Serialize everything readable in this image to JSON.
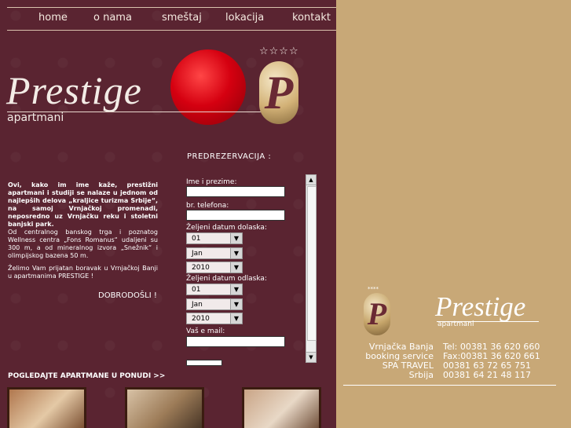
{
  "nav": {
    "items": [
      "home",
      "o nama",
      "smeštaj",
      "lokacija",
      "kontakt"
    ]
  },
  "logo": {
    "word": "Prestige",
    "sub": "apartmani",
    "stars": "☆☆☆☆",
    "badge_letter": "P"
  },
  "intro": {
    "p1": "Ovi, kako im ime kaže, prestižni apartmani i studiji se nalaze u jednom od najlepših delova „kraljice turizma Srbije“, na samoj Vrnjačkoj promenadi, neposredno uz Vrnjačku reku i stoletni banjski park.",
    "p2": "Od centralnog banskog trga i poznatog Wellness centra „Fons Romanus“ udaljeni su 300 m, a od mineralnog izvora „Snežnik“ i olimpijskog bazena 50 m.",
    "p3": "Želimo Vam prijatan boravak u Vrnjačkoj Banji u apartmanima PRESTIGE !",
    "welcome": "DOBRODOŠLI !"
  },
  "reservation": {
    "title": "PREDREZERVACIJA :",
    "name_label": "Ime i prezime:",
    "phone_label": "br. telefona:",
    "arrival_label": "Željeni datum dolaska:",
    "departure_label": "Željeni datum odlaska:",
    "email_label": "Vaš e mail:",
    "arrival": {
      "day": "01",
      "month": "Jan",
      "year": "2010"
    },
    "departure": {
      "day": "01",
      "month": "Jan",
      "year": "2010"
    }
  },
  "apartments": {
    "link": "POGLEDAJTE APARTMANE U PONUDI >>"
  },
  "contact": {
    "stars": "****",
    "word": "Prestige",
    "sub": "apartmani",
    "badge_letter": "P",
    "left": [
      "Vrnjačka Banja",
      "booking service",
      "SPA TRAVEL",
      "Srbija"
    ],
    "right": [
      "Tel: 00381 36 620 660",
      "Fax:00381 36 620 661",
      "00381 63 72 65 751",
      "00381 64 21 48 117"
    ]
  },
  "colors": {
    "left_bg": "#5a2431",
    "right_bg": "#c8a877",
    "accent_red": "#d50010"
  }
}
